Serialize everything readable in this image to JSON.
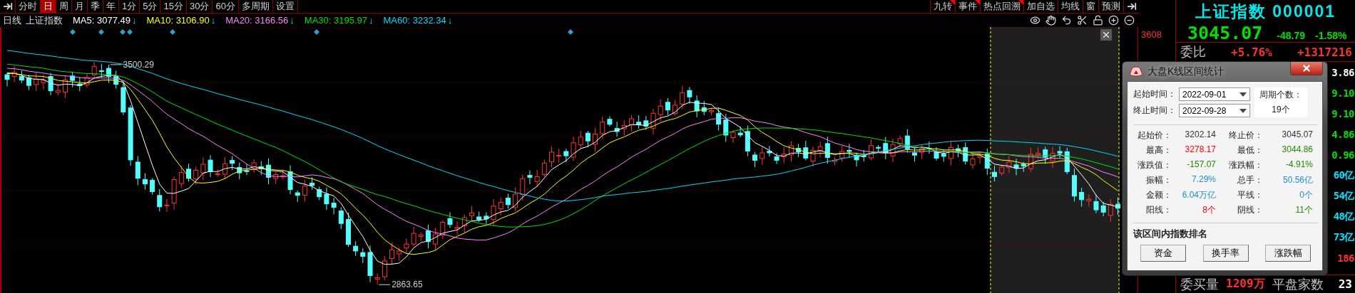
{
  "toolbar": {
    "left": [
      {
        "label": "分时",
        "selected": false
      },
      {
        "label": "日",
        "selected": true
      },
      {
        "label": "周",
        "selected": false
      },
      {
        "label": "月",
        "selected": false
      },
      {
        "label": "季",
        "selected": false
      },
      {
        "label": "年",
        "selected": false
      },
      {
        "label": "1分",
        "selected": false
      },
      {
        "label": "5分",
        "selected": false
      },
      {
        "label": "15分",
        "selected": false
      },
      {
        "label": "30分",
        "selected": false
      },
      {
        "label": "60分",
        "selected": false
      },
      {
        "label": "多周期",
        "selected": false
      },
      {
        "label": "设置",
        "selected": false
      }
    ],
    "right": [
      {
        "label": "九转",
        "flagged": true
      },
      {
        "label": "事件",
        "flagged": true
      },
      {
        "label": "热点回溯",
        "flagged": true
      },
      {
        "label": "加自选",
        "flagged": false
      },
      {
        "label": "均线",
        "flagged": false
      },
      {
        "label": "窗",
        "flagged": false
      },
      {
        "label": "预测",
        "flagged": false
      }
    ]
  },
  "legend": {
    "period": "日线",
    "name": "上证指数",
    "averages": [
      {
        "label": "MA5: 3077.49",
        "arrow": "↓",
        "color": "#ffffff"
      },
      {
        "label": "MA10: 3106.90",
        "arrow": "↓",
        "color": "#ffff00"
      },
      {
        "label": "MA20: 3166.56",
        "arrow": "↓",
        "color": "#ff80ff"
      },
      {
        "label": "MA30: 3195.97",
        "arrow": "↓",
        "color": "#00e000"
      },
      {
        "label": "MA60: 3232.34",
        "arrow": "↓",
        "color": "#00d8ff"
      }
    ]
  },
  "chart": {
    "high_label": "3500.29",
    "low_label": "2863.65",
    "axis_label": "3608"
  },
  "quote": {
    "title": "上证指数 000001",
    "price": "3045.07",
    "change": "-48.79",
    "change_pct": "-1.58%",
    "ratio": {
      "label": "委比",
      "pct": "+5.76%",
      "value": "+1317216"
    },
    "values": [
      {
        "text": "3.86",
        "color": "#ffffff"
      },
      {
        "text": "9.10",
        "color": "#00e000"
      },
      {
        "text": "9.10",
        "color": "#00e000"
      },
      {
        "text": "4.86",
        "color": "#00e000"
      },
      {
        "text": "0.96",
        "color": "#00e000"
      },
      {
        "text": "60亿",
        "color": "#00e0ff"
      },
      {
        "text": "54亿",
        "color": "#00e0ff"
      },
      {
        "text": "48亿",
        "color": "#00e0ff"
      },
      {
        "text": "73亿",
        "color": "#00e0ff"
      },
      {
        "text": "186",
        "color": "#ff3030"
      }
    ],
    "bottom": {
      "label": "委买量",
      "value": "1209万",
      "label2": "平盘家数",
      "value2": "23"
    }
  },
  "dialog": {
    "title": "大盘K线区间统计",
    "start_label": "起始时间：",
    "start": "2022-09-01",
    "end_label": "终止时间：",
    "end": "2022-09-28",
    "count_label": "周期个数：",
    "count": "19个",
    "stats": [
      {
        "label": "起始价：",
        "value": "3202.14",
        "color": "#333333"
      },
      {
        "label": "终止价：",
        "value": "3045.07",
        "color": "#333333"
      },
      {
        "label": "最高：",
        "value": "3278.17",
        "color": "#ff0000"
      },
      {
        "label": "最低：",
        "value": "3044.86",
        "color": "#208a00"
      },
      {
        "label": "涨跌值：",
        "value": "-157.07",
        "color": "#208a00"
      },
      {
        "label": "涨跌幅：",
        "value": "-4.91%",
        "color": "#208a00"
      },
      {
        "label": "振幅：",
        "value": "7.29%",
        "color": "#1e8fd0"
      },
      {
        "label": "总手：",
        "value": "50.56亿",
        "color": "#1e8fd0"
      },
      {
        "label": "金额：",
        "value": "6.04万亿",
        "color": "#1e8fd0"
      },
      {
        "label": "平线：",
        "value": "0个",
        "color": "#1e8fd0"
      },
      {
        "label": "阳线：",
        "value": "8个",
        "color": "#ff0000"
      },
      {
        "label": "阴线：",
        "value": "11个",
        "color": "#208a00"
      }
    ],
    "section": "该区间内指数排名",
    "buttons": [
      "资金",
      "换手率",
      "涨跌幅"
    ]
  }
}
